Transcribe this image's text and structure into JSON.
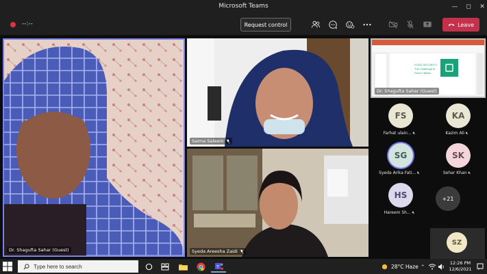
{
  "window": {
    "title": "Microsoft Teams"
  },
  "toolbar": {
    "timer": "--:--",
    "request_control_label": "Request control",
    "leave_label": "Leave"
  },
  "colors": {
    "accent": "#7b83eb",
    "leave": "#c4314b",
    "recording": "#e0323d"
  },
  "tiles": {
    "main": {
      "name": "Dr. Shagufta Sahar (Guest)"
    },
    "saima": {
      "name": "Saima Saleem"
    },
    "syeda": {
      "name": "Syeda Areesha Zaidi"
    },
    "share": {
      "name": "Dr. Shagufta Sahar (Guest)",
      "slide_title_1": "FOOD SECURITY:",
      "slide_title_2": "The Challenge to",
      "slide_title_3": "Feed 9 Billion"
    }
  },
  "roster": [
    {
      "initials": "FS",
      "name": "Farhat ulain...",
      "muted": true
    },
    {
      "initials": "KA",
      "name": "Kazim Ali",
      "muted": true
    },
    {
      "initials": "SG",
      "name": "Syeda Arika Fati...",
      "muted": true,
      "speaking": true
    },
    {
      "initials": "SK",
      "name": "Sehar Khan",
      "muted": true
    },
    {
      "initials": "HS",
      "name": "Hareem Sh...",
      "muted": true
    }
  ],
  "overflow": {
    "label": "+21"
  },
  "self": {
    "initials": "SZ"
  },
  "taskbar": {
    "search_placeholder": "Type here to search",
    "weather": "28°C  Haze",
    "time": "12:26 PM",
    "date": "12/6/2021"
  }
}
